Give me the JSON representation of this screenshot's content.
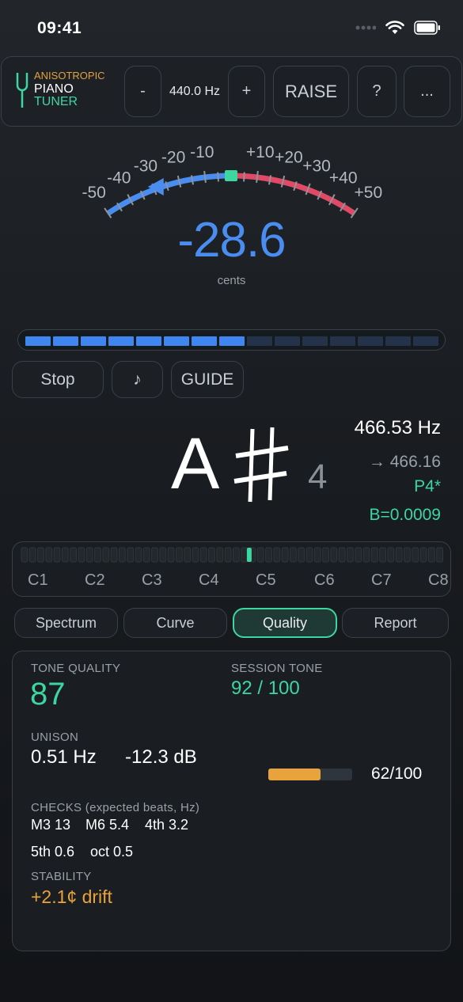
{
  "status": {
    "time": "09:41"
  },
  "header": {
    "brand_line1": "ANISOTROPIC",
    "brand_line2": "PIANO",
    "brand_line3": "TUNER",
    "minus_label": "-",
    "frequency": "440.0 Hz",
    "plus_label": "+",
    "raise_label": "RAISE",
    "help_label": "?",
    "more_label": "..."
  },
  "gauge": {
    "value": "-28.6",
    "unit": "cents",
    "needle_cents": -28.6,
    "ticks_left": [
      "-50",
      "-40",
      "-30",
      "-20",
      "-10"
    ],
    "ticks_right": [
      "+10",
      "+20",
      "+30",
      "+40",
      "+50"
    ],
    "colors": {
      "flat": "#4a8df0",
      "sharp": "#e04a66",
      "center": "#3dd6a0"
    }
  },
  "level_meter": {
    "total_segments": 15,
    "active_segments": 8
  },
  "controls": {
    "stop_label": "Stop",
    "note_label": "♪",
    "guide_label": "GUIDE"
  },
  "note": {
    "letter": "A",
    "accidental": "sharp",
    "octave": "4",
    "frequency": "466.53 Hz",
    "target": "→ 466.16",
    "interval": "P4*",
    "inharmonicity": "B=0.0009"
  },
  "keyboard": {
    "labels": [
      "C1",
      "C2",
      "C3",
      "C4",
      "C5",
      "C6",
      "C7",
      "C8"
    ],
    "marker_fraction": 0.54
  },
  "tabs": {
    "items": [
      "Spectrum",
      "Curve",
      "Quality",
      "Report"
    ],
    "active": "Quality"
  },
  "quality": {
    "tone_quality_label": "TONE QUALITY",
    "tone_quality_value": "87",
    "session_tone_label": "SESSION TONE",
    "session_tone_value": "92 / 100",
    "unison_label": "UNISON",
    "unison_hz": "0.51 Hz",
    "unison_db": "-12.3 dB",
    "unison_score": "62/100",
    "unison_score_fraction": 0.62,
    "checks_label": "CHECKS (expected beats, Hz)",
    "checks_row1": [
      "M3 13",
      "M6 5.4",
      "4th 3.2"
    ],
    "checks_row2": [
      "5th 0.6",
      "oct 0.5"
    ],
    "stability_label": "STABILITY",
    "stability_value": "+2.1¢ drift"
  }
}
